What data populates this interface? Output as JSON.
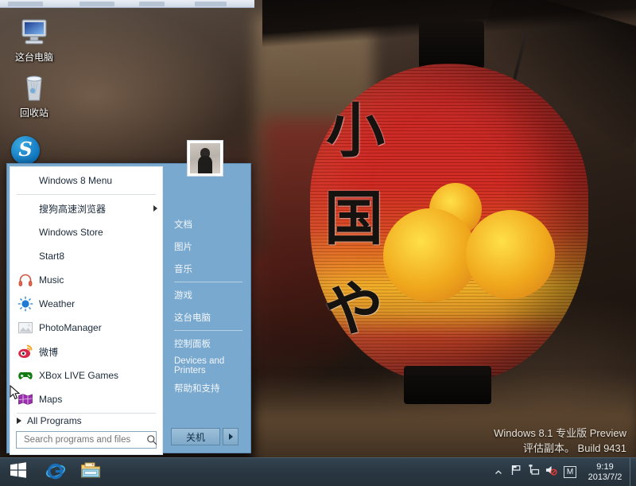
{
  "desktop": {
    "icons": [
      {
        "name": "this-pc",
        "label": "这台电脑",
        "icon": "computer-icon"
      },
      {
        "name": "recycle-bin",
        "label": "回收站",
        "icon": "recycle-bin-icon"
      }
    ],
    "watermark": {
      "line1": "Windows 8.1 专业版 Preview",
      "line2": "评估副本。  Build 9431"
    }
  },
  "start_menu": {
    "accent_color": "#7aa9cf",
    "left_pane": {
      "items": [
        {
          "label": "Windows 8 Menu",
          "icon": "none",
          "has_submenu": false,
          "indent": true
        },
        {
          "label": "搜狗高速浏览器",
          "icon": "none",
          "has_submenu": true,
          "indent": true
        },
        {
          "label": "Windows Store",
          "icon": "none",
          "has_submenu": false,
          "indent": true
        },
        {
          "label": "Start8",
          "icon": "none",
          "has_submenu": false,
          "indent": true
        },
        {
          "label": "Music",
          "icon": "headphones-icon",
          "has_submenu": false,
          "indent": false
        },
        {
          "label": "Weather",
          "icon": "sun-icon",
          "has_submenu": false,
          "indent": false
        },
        {
          "label": "PhotoManager",
          "icon": "photo-icon",
          "has_submenu": false,
          "indent": false
        },
        {
          "label": "微博",
          "icon": "weibo-icon",
          "has_submenu": false,
          "indent": false
        },
        {
          "label": "XBox LIVE Games",
          "icon": "xbox-controller-icon",
          "has_submenu": false,
          "indent": false
        },
        {
          "label": "Maps",
          "icon": "maps-icon",
          "has_submenu": false,
          "indent": false
        }
      ],
      "all_programs_label": "All Programs",
      "search": {
        "placeholder": "Search programs and files",
        "value": "",
        "icon": "search-icon"
      }
    },
    "right_pane": {
      "avatar": "user-avatar",
      "items": [
        {
          "label": "文档"
        },
        {
          "label": "图片"
        },
        {
          "label": "音乐"
        },
        {
          "label": "游戏"
        },
        {
          "label": "这台电脑"
        },
        {
          "label": "控制面板"
        },
        {
          "label": "Devices and Printers"
        },
        {
          "label": "帮助和支持"
        }
      ],
      "shutdown_label": "关机",
      "shutdown_arrow_icon": "chevron-right-icon"
    }
  },
  "taskbar": {
    "start_button": "windows-logo-icon",
    "apps": [
      {
        "name": "internet-explorer",
        "icon": "internet-explorer-icon"
      },
      {
        "name": "file-explorer",
        "icon": "folder-icon"
      }
    ],
    "tray": {
      "overflow_icon": "chevron-up-icon",
      "icons": [
        {
          "name": "action-center",
          "icon": "flag-icon"
        },
        {
          "name": "network",
          "icon": "network-icon"
        },
        {
          "name": "volume",
          "icon": "speaker-muted-icon"
        }
      ],
      "ime_label": "M",
      "clock": {
        "time": "9:19",
        "date": "2013/7/2"
      }
    }
  },
  "overlay": {
    "sogou_logo": "S",
    "lantern_kanji": [
      "小",
      "国",
      "や"
    ]
  }
}
